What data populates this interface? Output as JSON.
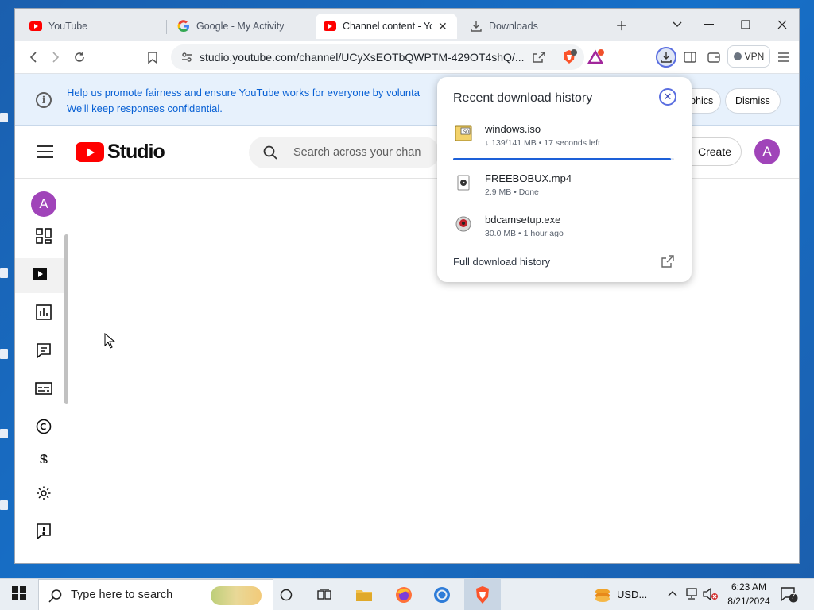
{
  "tabs": [
    {
      "title": "YouTube",
      "favicon": "youtube-favicon"
    },
    {
      "title": "Google - My Activity",
      "favicon": "google-favicon"
    },
    {
      "title": "Channel content - Yo",
      "favicon": "youtube-favicon",
      "active": true
    },
    {
      "title": "Downloads",
      "favicon": "download-icon"
    }
  ],
  "address_bar": {
    "url": "studio.youtube.com/channel/UCyXsEOTbQWPTM-429OT4shQ/..."
  },
  "toolbar": {
    "vpn_label": "VPN",
    "brave_shields_badge": "4",
    "rewards_badge": "3"
  },
  "banner": {
    "message_line1": "Help us promote fairness and ensure YouTube works for everyone by volunta",
    "message_line2": "We'll keep responses confidential.",
    "demographics_label": "graphics",
    "dismiss_label": "Dismiss"
  },
  "studio": {
    "logo_text": "Studio",
    "search_placeholder": "Search across your chan",
    "create_label": "Create",
    "avatar_letter": "A"
  },
  "sidenav": {
    "avatar_letter": "A"
  },
  "downloads": {
    "title": "Recent download history",
    "items": [
      {
        "name": "windows.iso",
        "status": "↓ 139/141 MB • 17 seconds left",
        "progress": 0.986
      },
      {
        "name": "FREEBOBUX.mp4",
        "status": "2.9 MB • Done"
      },
      {
        "name": "bdcamsetup.exe",
        "status": "30.0 MB • 1 hour ago"
      }
    ],
    "full_history_label": "Full download history"
  },
  "taskbar": {
    "search_placeholder": "Type here to search",
    "currency_label": "USD...",
    "time": "6:23 AM",
    "date": "8/21/2024",
    "notification_count": "7"
  },
  "colors": {
    "accent_blue": "#1d60d8",
    "youtube_red": "#ff0000",
    "avatar_purple": "#a044b9"
  }
}
